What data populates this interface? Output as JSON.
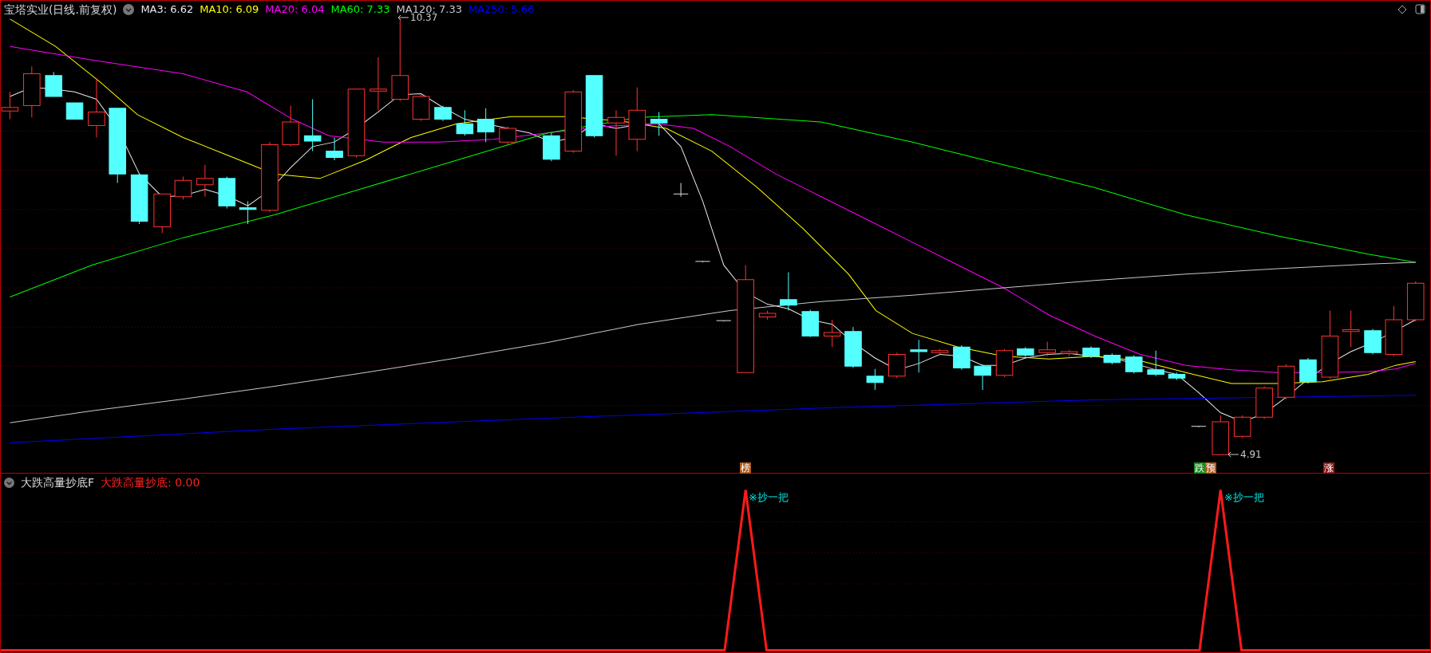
{
  "chart_header": {
    "title": "宝塔实业(日线.前复权)",
    "indicators": [
      {
        "label": "MA3: 6.62",
        "color": "#e8e8e8"
      },
      {
        "label": "MA10: 6.09",
        "color": "#ffff00"
      },
      {
        "label": "MA20: 6.04",
        "color": "#ff00ff"
      },
      {
        "label": "MA60: 7.33",
        "color": "#00ff00"
      },
      {
        "label": "MA120: 7.33",
        "color": "#c8c8c8"
      },
      {
        "label": "MA250: 5.66",
        "color": "#0000ff"
      }
    ]
  },
  "price_labels": [
    {
      "text": "10.37"
    },
    {
      "text": "4.91"
    }
  ],
  "signal_markers": [
    {
      "chars": [
        {
          "text": "榜",
          "color": "#b0581c"
        }
      ]
    },
    {
      "chars": [
        {
          "text": "跌",
          "color": "#1c8a1c"
        },
        {
          "text": "预",
          "color": "#b0581c"
        }
      ]
    },
    {
      "chars": [
        {
          "text": "涨",
          "color": "#8c1c1c"
        }
      ]
    }
  ],
  "indicator_panel": {
    "title": "大跌高量抄底F",
    "value_label": "大跌高量抄底: 0.00",
    "signals": [
      "※抄一把",
      "※抄一把"
    ]
  }
}
